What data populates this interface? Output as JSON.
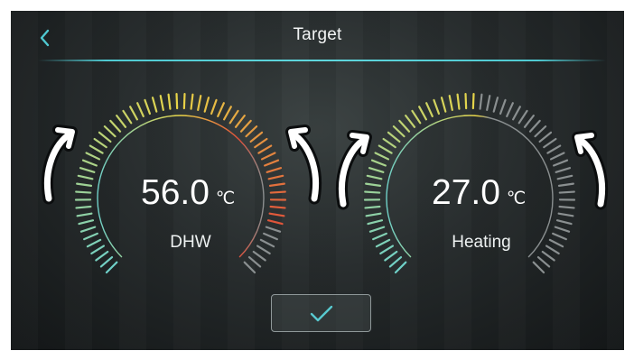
{
  "header": {
    "title": "Target"
  },
  "dials": [
    {
      "value": "56.0",
      "unit": "℃",
      "label": "DHW"
    },
    {
      "value": "27.0",
      "unit": "℃",
      "label": "Heating"
    }
  ],
  "icons": {
    "back": "chevron-left-icon",
    "confirm": "checkmark-icon",
    "adjust": "curved-arrow-up-icon"
  },
  "colors": {
    "accent": "#4fc9d1",
    "gauge_cool": "#6fd0c8",
    "gauge_warm": "#e8d447",
    "gauge_hot": "#e0503a",
    "gauge_inactive": "#8a8f90"
  }
}
